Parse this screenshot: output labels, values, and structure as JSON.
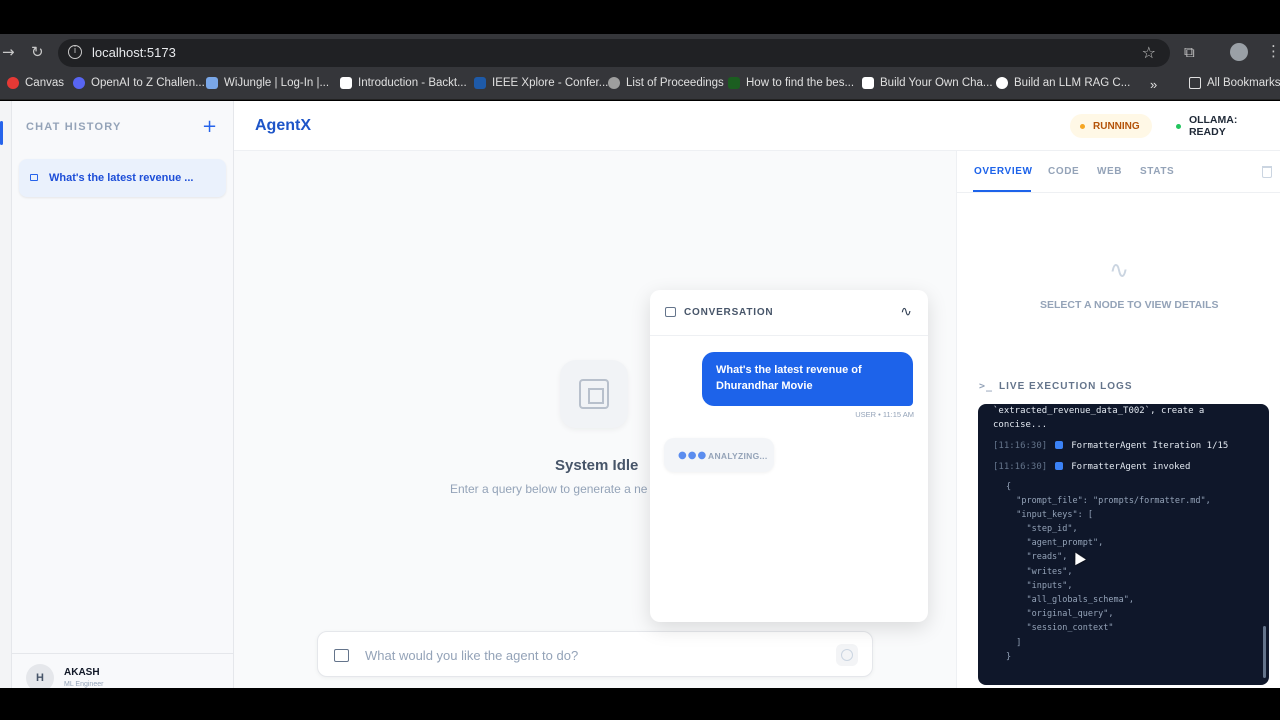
{
  "browser": {
    "url": "localhost:5173",
    "bookmarks": [
      {
        "label": "Canvas",
        "color": "#e53935"
      },
      {
        "label": "OpenAI to Z Challen...",
        "color": "#5865f2"
      },
      {
        "label": "WiJungle | Log-In |...",
        "color": "#7aa7e8"
      },
      {
        "label": "Introduction - Backt...",
        "color": "#ffffff"
      },
      {
        "label": "IEEE Xplore - Confer...",
        "color": "#1e5aa8"
      },
      {
        "label": "List of Proceedings",
        "color": "#9e9e9e"
      },
      {
        "label": "How to find the bes...",
        "color": "#1b5e20"
      },
      {
        "label": "Build Your Own Cha...",
        "color": "#ffffff"
      },
      {
        "label": "Build an LLM RAG C...",
        "color": "#ffffff"
      }
    ],
    "more": "»",
    "all_bookmarks": "All Bookmarks"
  },
  "sidebar": {
    "title": "CHAT HISTORY",
    "plus": "+",
    "chats": [
      {
        "label": "What's the latest revenue ..."
      }
    ],
    "user": {
      "initial": "H",
      "name": "AKASH",
      "role": "ML Engineer"
    }
  },
  "header": {
    "logo": "AgentX",
    "status_running": "RUNNING",
    "status_ready": "OLLAMA: READY",
    "running_color": "#f5a623",
    "ready_color": "#22c55e"
  },
  "main": {
    "idle_title": "System Idle",
    "idle_subtitle": "Enter a query below to generate a ne",
    "query_placeholder": "What would you like the agent to do?"
  },
  "conversation": {
    "title": "CONVERSATION",
    "pulse_icon": "∿",
    "message": "What's the latest revenue of Dhurandhar Movie",
    "meta": "USER • 11:15 AM",
    "analyzing_dots": "●●●",
    "analyzing": "ANALYZING..."
  },
  "details": {
    "tabs": [
      "OVERVIEW",
      "CODE",
      "WEB",
      "STATS"
    ],
    "node_icon": "∿",
    "node_hint": "SELECT A NODE TO VIEW DETAILS",
    "logs_prompt": ">_",
    "logs_title": "LIVE EXECUTION LOGS",
    "log_top_1": "`extracted_revenue_data_T002`, create a",
    "log_top_2": "concise...",
    "log_entries": [
      {
        "time": "[11:16:30]",
        "text": "FormatterAgent Iteration 1/15",
        "color": "#3b82f6"
      },
      {
        "time": "[11:16:30]",
        "text": "FormatterAgent invoked",
        "color": "#3b82f6"
      }
    ],
    "json_lines": [
      "{",
      "  \"prompt_file\": \"prompts/formatter.md\",",
      "  \"input_keys\": [",
      "    \"step_id\",",
      "    \"agent_prompt\",",
      "    \"reads\",",
      "    \"writes\",",
      "    \"inputs\",",
      "    \"all_globals_schema\",",
      "    \"original_query\",",
      "    \"session_context\"",
      "  ]",
      "}"
    ]
  }
}
